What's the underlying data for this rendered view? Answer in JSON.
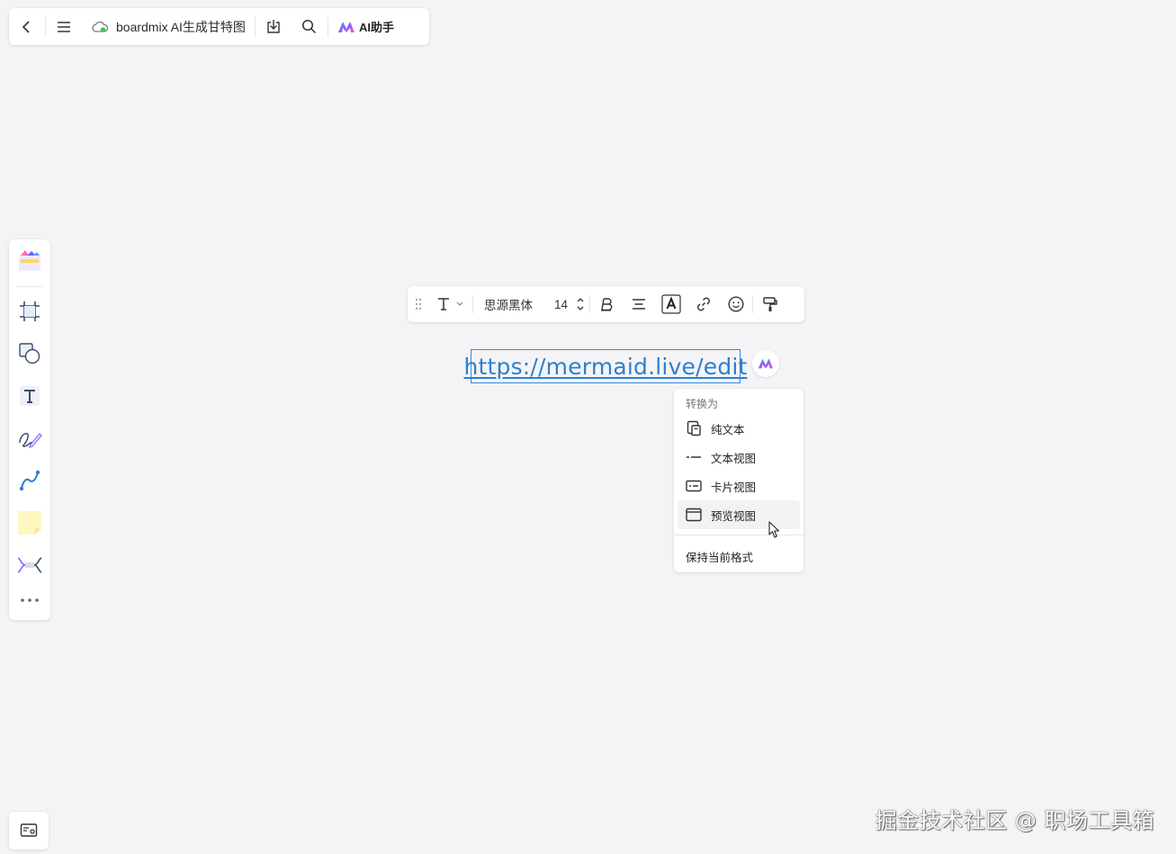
{
  "topbar": {
    "title": "boardmix AI生成甘特图",
    "ai_label": "AI助手"
  },
  "format_toolbar": {
    "font_family": "思源黑体",
    "font_size": "14"
  },
  "canvas": {
    "link_text": "https://mermaid.live/edit"
  },
  "convert_menu": {
    "header": "转换为",
    "items": [
      {
        "label": "纯文本",
        "icon": "plain-text-icon"
      },
      {
        "label": "文本视图",
        "icon": "text-view-icon"
      },
      {
        "label": "卡片视图",
        "icon": "card-view-icon"
      },
      {
        "label": "预览视图",
        "icon": "preview-view-icon"
      }
    ],
    "footer": "保持当前格式"
  },
  "watermark": "掘金技术社区 @ 职场工具箱",
  "colors": {
    "accent": "#2e7fd0",
    "background": "#f4f4f6"
  }
}
